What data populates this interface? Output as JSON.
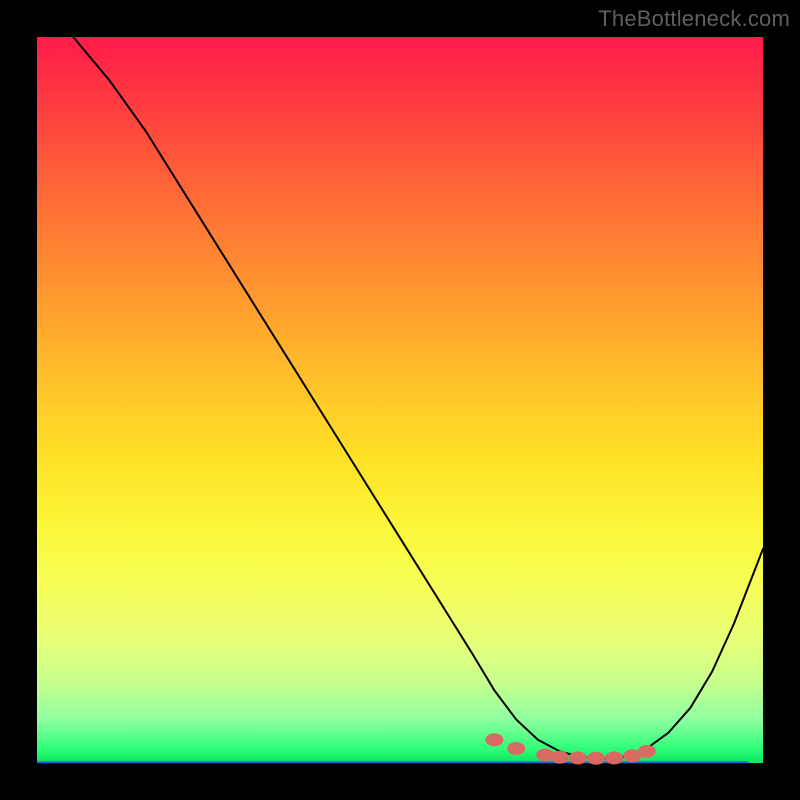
{
  "watermark": "TheBottleneck.com",
  "colors": {
    "background_black": "#000000",
    "gradient_top": "#ff1a4a",
    "gradient_bottom": "#08e85f",
    "curve": "#000000",
    "dots": "#d96a63",
    "blue_line": "#1e6ae6"
  },
  "chart_data": {
    "type": "line",
    "title": "",
    "xlabel": "",
    "ylabel": "",
    "xlim": [
      0,
      100
    ],
    "ylim": [
      0,
      100
    ],
    "grid": false,
    "legend": false,
    "series": [
      {
        "name": "bottleneck-curve",
        "x": [
          5,
          10,
          15,
          20,
          25,
          30,
          35,
          40,
          45,
          50,
          55,
          60,
          63,
          66,
          69,
          72,
          75,
          78,
          81,
          84,
          87,
          90,
          93,
          96,
          100
        ],
        "y": [
          100,
          94,
          87,
          79,
          71,
          63,
          55,
          47,
          39,
          31,
          23,
          15,
          10,
          6,
          3.2,
          1.6,
          0.8,
          0.6,
          0.9,
          2.0,
          4.2,
          7.6,
          12.6,
          19.2,
          29.5
        ]
      }
    ],
    "markers": {
      "name": "flat-region-dots",
      "x": [
        63,
        66,
        70,
        72,
        74.5,
        77,
        79.5,
        82,
        84
      ],
      "y": [
        3.2,
        2.0,
        1.1,
        0.8,
        0.7,
        0.65,
        0.7,
        1.0,
        1.6
      ]
    },
    "reference_lines": [
      {
        "name": "blue-bottom-line",
        "y": 0.1,
        "x_start": 0,
        "x_end": 98
      }
    ]
  }
}
